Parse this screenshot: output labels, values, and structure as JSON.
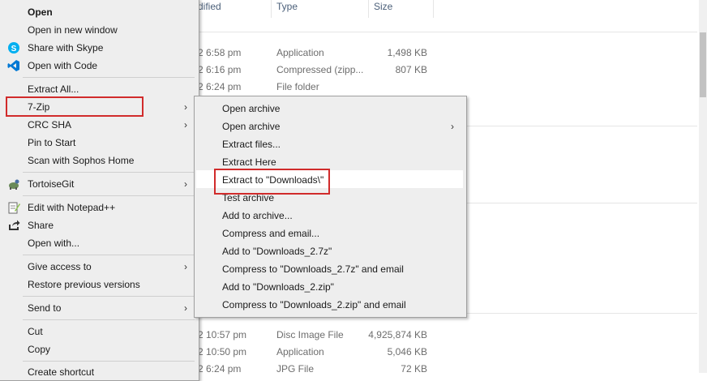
{
  "columns": {
    "date_partial": "dified",
    "type": "Type",
    "size": "Size"
  },
  "rows": [
    {
      "date": "2 6:58 pm",
      "type": "Application",
      "size": "1,498 KB"
    },
    {
      "date": "2 6:16 pm",
      "type": "Compressed (zipp...",
      "size": "807 KB"
    },
    {
      "date": "2 6:24 pm",
      "type": "File folder",
      "size": ""
    },
    {
      "date": "2 10:57 pm",
      "type": "Disc Image File",
      "size": "4,925,874 KB"
    },
    {
      "date": "2 10:50 pm",
      "type": "Application",
      "size": "5,046 KB"
    },
    {
      "date": "2 6:24 pm",
      "type": "JPG File",
      "size": "72 KB"
    }
  ],
  "main_menu": {
    "items": [
      {
        "label": "Open",
        "bold": true,
        "icon": ""
      },
      {
        "label": "Open in new window",
        "icon": ""
      },
      {
        "label": "Share with Skype",
        "icon": "skype-icon"
      },
      {
        "label": "Open with Code",
        "icon": "vscode-icon"
      },
      {
        "label": "Extract All...",
        "icon": ""
      },
      {
        "label": "7-Zip",
        "icon": "",
        "submenu": true
      },
      {
        "label": "CRC SHA",
        "icon": "",
        "submenu": true
      },
      {
        "label": "Pin to Start",
        "icon": ""
      },
      {
        "label": "Scan with Sophos Home",
        "icon": ""
      },
      {
        "label": "TortoiseGit",
        "icon": "tortoisegit-icon",
        "submenu": true
      },
      {
        "label": "Edit with Notepad++",
        "icon": "notepad-plus-plus-icon"
      },
      {
        "label": "Share",
        "icon": "share-icon"
      },
      {
        "label": "Open with...",
        "icon": ""
      },
      {
        "label": "Give access to",
        "icon": "",
        "submenu": true
      },
      {
        "label": "Restore previous versions",
        "icon": ""
      },
      {
        "label": "Send to",
        "icon": "",
        "submenu": true
      },
      {
        "label": "Cut",
        "icon": ""
      },
      {
        "label": "Copy",
        "icon": ""
      },
      {
        "label": "Create shortcut",
        "icon": ""
      }
    ]
  },
  "sevenzip_menu": {
    "items": [
      {
        "label": "Open archive"
      },
      {
        "label": "Open archive",
        "submenu": true
      },
      {
        "label": "Extract files..."
      },
      {
        "label": "Extract Here"
      },
      {
        "label": "Extract to \"Downloads\\\""
      },
      {
        "label": "Test archive"
      },
      {
        "label": "Add to archive..."
      },
      {
        "label": "Compress and email..."
      },
      {
        "label": "Add to \"Downloads_2.7z\""
      },
      {
        "label": "Compress to \"Downloads_2.7z\" and email"
      },
      {
        "label": "Add to \"Downloads_2.zip\""
      },
      {
        "label": "Compress to \"Downloads_2.zip\" and email"
      }
    ]
  },
  "colors": {
    "menu_bg": "#eeeeee",
    "highlight_border": "#d12b2b",
    "skype": "#00aff0",
    "vscode": "#0078d4"
  }
}
